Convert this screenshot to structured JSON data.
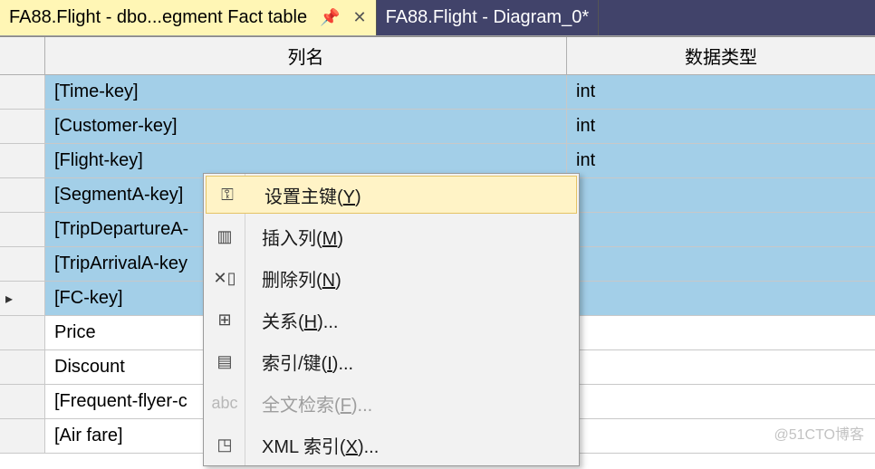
{
  "tabs": [
    {
      "title": "FA88.Flight - dbo...egment Fact table",
      "active": true
    },
    {
      "title": "FA88.Flight - Diagram_0*",
      "active": false
    }
  ],
  "headers": {
    "column_name": "列名",
    "data_type": "数据类型"
  },
  "rows": [
    {
      "name": "[Time-key]",
      "type": "int",
      "selected": true,
      "marker": ""
    },
    {
      "name": "[Customer-key]",
      "type": "int",
      "selected": true,
      "marker": ""
    },
    {
      "name": "[Flight-key]",
      "type": "int",
      "selected": true,
      "marker": ""
    },
    {
      "name": "[SegmentA-key]",
      "type": "",
      "selected": true,
      "marker": ""
    },
    {
      "name": "[TripDepartureA-",
      "type": "",
      "selected": true,
      "marker": ""
    },
    {
      "name": "[TripArrivalA-key",
      "type": "",
      "selected": true,
      "marker": ""
    },
    {
      "name": "[FC-key]",
      "type": "",
      "selected": true,
      "marker": "▸"
    },
    {
      "name": "Price",
      "type": "",
      "selected": false,
      "marker": ""
    },
    {
      "name": "Discount",
      "type": "",
      "selected": false,
      "marker": ""
    },
    {
      "name": "[Frequent-flyer-c",
      "type": "",
      "selected": false,
      "marker": ""
    },
    {
      "name": "[Air fare]",
      "type": "",
      "selected": false,
      "marker": ""
    }
  ],
  "context_menu": {
    "items": [
      {
        "icon": "key-icon",
        "glyph": "⚿",
        "label_pre": "设置主键(",
        "mnemonic": "Y",
        "label_post": ")",
        "highlight": true,
        "disabled": false
      },
      {
        "icon": "insert-column-icon",
        "glyph": "▥",
        "label_pre": "插入列(",
        "mnemonic": "M",
        "label_post": ")",
        "highlight": false,
        "disabled": false
      },
      {
        "icon": "delete-column-icon",
        "glyph": "✕▯",
        "label_pre": "删除列(",
        "mnemonic": "N",
        "label_post": ")",
        "highlight": false,
        "disabled": false
      },
      {
        "icon": "relationship-icon",
        "glyph": "⊞",
        "label_pre": "关系(",
        "mnemonic": "H",
        "label_post": ")...",
        "highlight": false,
        "disabled": false
      },
      {
        "icon": "index-icon",
        "glyph": "▤",
        "label_pre": "索引/键(",
        "mnemonic": "I",
        "label_post": ")...",
        "highlight": false,
        "disabled": false
      },
      {
        "icon": "fulltext-icon",
        "glyph": "abc",
        "label_pre": "全文检索(",
        "mnemonic": "F",
        "label_post": ")...",
        "highlight": false,
        "disabled": true
      },
      {
        "icon": "xml-index-icon",
        "glyph": "◳",
        "label_pre": "XML 索引(",
        "mnemonic": "X",
        "label_post": ")...",
        "highlight": false,
        "disabled": false
      }
    ]
  },
  "watermark": "@51CTO博客"
}
